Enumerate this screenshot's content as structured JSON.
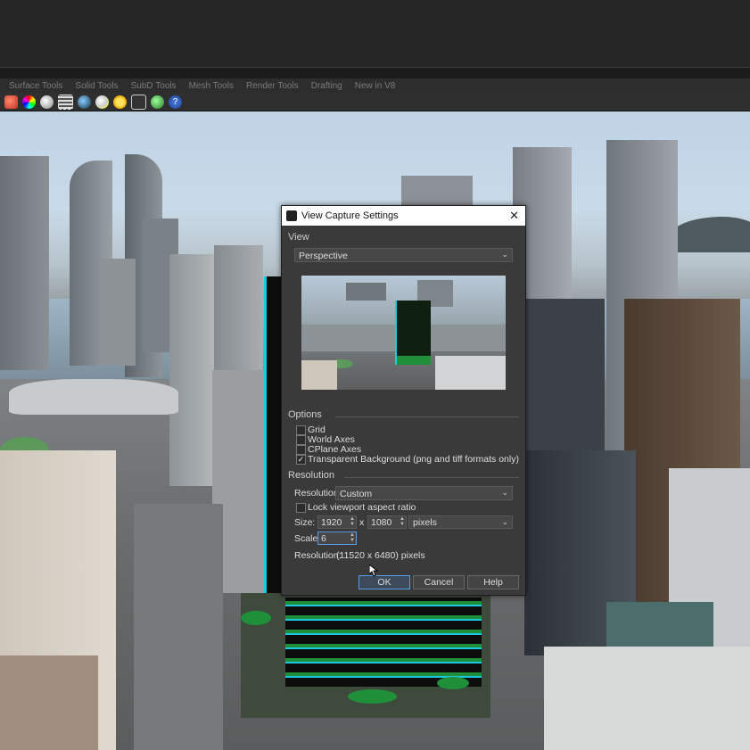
{
  "tabs": [
    "Surface Tools",
    "Solid Tools",
    "SubD Tools",
    "Mesh Tools",
    "Render Tools",
    "Drafting",
    "New in V8"
  ],
  "toolbar_icons": [
    "rendered-sphere-icon",
    "color-wheel-icon",
    "sphere-icon",
    "grid-select-icon",
    "blue-sphere-icon",
    "light-bulb-icon",
    "sun-icon",
    "network-icon",
    "globe-icon",
    "help-icon"
  ],
  "dialog": {
    "title": "View Capture Settings",
    "close": "✕",
    "view_section": "View",
    "view_select": "Perspective",
    "options_section": "Options",
    "options": [
      {
        "label": "Grid",
        "checked": false
      },
      {
        "label": "World Axes",
        "checked": false
      },
      {
        "label": "CPlane Axes",
        "checked": false
      },
      {
        "label": "Transparent Background (png and tiff formats only)",
        "checked": true
      }
    ],
    "resolution_section": "Resolution",
    "resolution_label": "Resolution:",
    "resolution_select": "Custom",
    "lock_label": "Lock viewport aspect ratio",
    "size_label": "Size:",
    "width": "1920",
    "x_sep": "x",
    "height": "1080",
    "unit_select": "pixels",
    "scale_label": "Scale:",
    "scale": "6",
    "result_label": "Resolution:",
    "result_value": "(11520 x 6480) pixels",
    "ok": "OK",
    "cancel": "Cancel",
    "help": "Help"
  },
  "colors": {
    "accent": "#5a9be6",
    "dialog_bg": "#3a3a3a",
    "building_glass": "#1ec8e0",
    "building_green": "#1f8f3a"
  }
}
